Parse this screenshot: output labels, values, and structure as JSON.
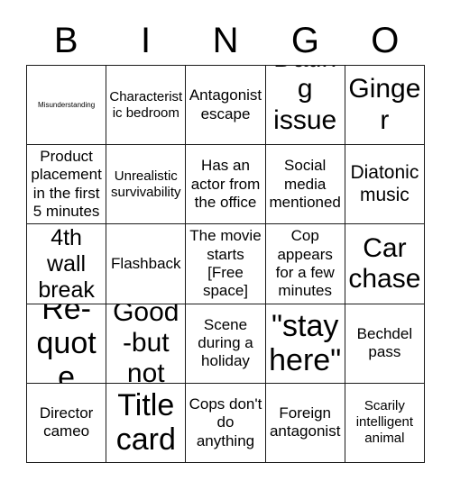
{
  "card": {
    "title": "BINGO",
    "header_letters": [
      "B",
      "I",
      "N",
      "G",
      "O"
    ],
    "grid_size": "5x5",
    "border_color": "#1a1a1a",
    "cell_background": "#ffffff",
    "text_color": "#000000",
    "rows": [
      [
        {
          "text": "Misunderstanding",
          "size": "fs-xxs",
          "free_space": false
        },
        {
          "text": "Characteristic bedroom",
          "size": "fs-s",
          "free_space": false
        },
        {
          "text": "Antagonist escape",
          "size": "fs-m",
          "free_space": false
        },
        {
          "text": "Dating issues",
          "size": "fs-xxl",
          "free_space": false
        },
        {
          "text": "Ginger",
          "size": "fs-xxl",
          "free_space": false
        }
      ],
      [
        {
          "text": "Product placement in the first 5 minutes",
          "size": "fs-m",
          "free_space": false
        },
        {
          "text": "Unrealistic survivability",
          "size": "fs-s",
          "free_space": false
        },
        {
          "text": "Has an actor from the office",
          "size": "fs-m",
          "free_space": false
        },
        {
          "text": "Social media mentioned",
          "size": "fs-m",
          "free_space": false
        },
        {
          "text": "Diatonic music",
          "size": "fs-l",
          "free_space": false
        }
      ],
      [
        {
          "text": "4th wall break",
          "size": "fs-xl",
          "free_space": false
        },
        {
          "text": "Flashback",
          "size": "fs-m",
          "free_space": false
        },
        {
          "text": "The movie starts [Free space]",
          "size": "fs-m",
          "free_space": true
        },
        {
          "text": "Cop appears for a few minutes",
          "size": "fs-m",
          "free_space": false
        },
        {
          "text": "Car chase",
          "size": "fs-xxl",
          "free_space": false
        }
      ],
      [
        {
          "text": "Re-quote",
          "size": "fs-3xl",
          "free_space": false
        },
        {
          "text": "Good-but not",
          "size": "fs-xxl",
          "free_space": false
        },
        {
          "text": "Scene during a holiday",
          "size": "fs-m",
          "free_space": false
        },
        {
          "text": "\"stay here\"",
          "size": "fs-3xl",
          "free_space": false
        },
        {
          "text": "Bechdel pass",
          "size": "fs-m",
          "free_space": false
        }
      ],
      [
        {
          "text": "Director cameo",
          "size": "fs-m",
          "free_space": false
        },
        {
          "text": "Title card",
          "size": "fs-3xl",
          "free_space": false
        },
        {
          "text": "Cops don't do anything",
          "size": "fs-m",
          "free_space": false
        },
        {
          "text": "Foreign antagonist",
          "size": "fs-m",
          "free_space": false
        },
        {
          "text": "Scarily intelligent animal",
          "size": "fs-s",
          "free_space": false
        }
      ]
    ]
  }
}
